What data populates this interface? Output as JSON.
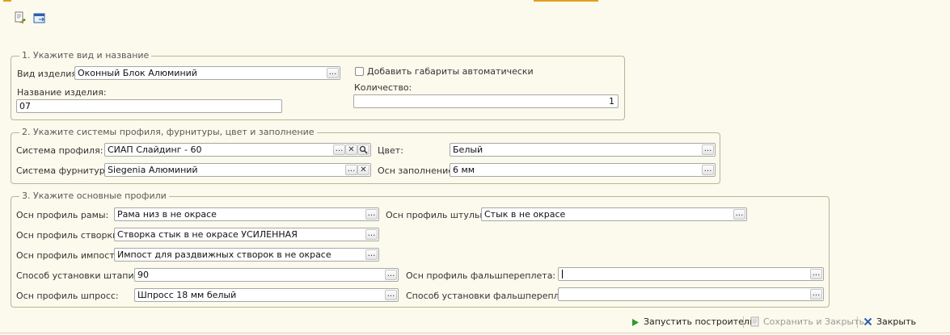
{
  "toolbar": {
    "icon1": "report-arrow-icon",
    "icon2": "window-export-icon"
  },
  "group1": {
    "title": "1. Укажите вид и название",
    "kind_label": "Вид изделия:",
    "kind_value": "Оконный Блок Алюминий",
    "name_label": "Название изделия:",
    "name_value": "07",
    "auto_dims_label": "Добавить габариты автоматически",
    "qty_label": "Количество:",
    "qty_value": "1"
  },
  "group2": {
    "title": "2. Укажите системы профиля, фурнитуры, цвет и заполнение",
    "profile_label": "Система профиля:",
    "profile_value": "СИАП Слайдинг - 60",
    "fittings_label": "Система фурнитуры:",
    "fittings_value": "Siegenia Алюминий",
    "color_label": "Цвет:",
    "color_value": "Белый",
    "fill_label": "Осн заполнение:",
    "fill_value": "6 мм"
  },
  "group3": {
    "title": "3. Укажите основные профили",
    "frame_label": "Осн профиль рамы:",
    "frame_value": "Рама низ в не окрасе",
    "sash_label": "Осн профиль створки:",
    "sash_value": "Створка стык в не окрасе УСИЛЕННАЯ",
    "impost_label": "Осн профиль импоста:",
    "impost_value": "Импост для раздвижных створок в не окрасе",
    "bead_label": "Способ установки штапика:",
    "bead_value": "90",
    "muntin_label": "Осн профиль шпросс:",
    "muntin_value": "Шпросс 18 мм белый",
    "mullion_label": "Осн профиль штульпа:",
    "mullion_value": "Стык в не окрасе",
    "false_frame_label": "Осн профиль фальшпереплета:",
    "false_frame_value": "",
    "false_frame_install_label": "Способ установки фальшпереплета:",
    "false_frame_install_value": ""
  },
  "footer": {
    "run_label": "Запустить построитель",
    "save_label": "Сохранить и Закрыть",
    "close_label": "Закрыть"
  },
  "button_glyphs": {
    "dots": "...",
    "clear": "✕",
    "search": "🔍"
  },
  "colors": {
    "background": "#fbfaec",
    "accent": "#e0a020",
    "run_icon": "#2e9a2e",
    "close_icon": "#2d5fb0"
  }
}
